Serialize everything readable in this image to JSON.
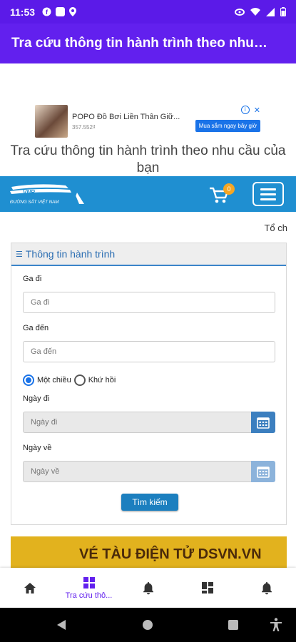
{
  "status_bar": {
    "time": "11:53",
    "brand_color": "#5b1ae8"
  },
  "app_bar": {
    "title": "Tra cứu thông tin hành trình theo nhu…"
  },
  "ad": {
    "title": "POPO Đồ Bơi Liền Thân Giữ...",
    "price": "357.552₫",
    "cta": "Mua sắm ngay bây giờ"
  },
  "page_title": "Tra cứu thông tin hành trình theo nhu cầu của bạn",
  "site_header": {
    "logo_text": "VNR",
    "logo_caption": "ĐƯỜNG SẮT VIỆT NAM",
    "cart_count": "0",
    "header_color": "#1f8fd1"
  },
  "top_link": "Tổ ch",
  "panel": {
    "title": "Thông tin hành trình",
    "departure_label": "Ga đi",
    "departure_placeholder": "Ga đi",
    "arrival_label": "Ga đến",
    "arrival_placeholder": "Ga đến",
    "one_way_label": "Một chiều",
    "round_trip_label": "Khứ hồi",
    "selected_trip_type": "one_way",
    "depart_date_label": "Ngày đi",
    "depart_date_placeholder": "Ngày đi",
    "return_date_label": "Ngày về",
    "return_date_placeholder": "Ngày về",
    "search_button": "Tìm kiếm"
  },
  "banner": {
    "text": "VÉ TÀU ĐIỆN TỬ DSVN.VN"
  },
  "bottom_nav": {
    "items": [
      {
        "icon": "home-icon"
      },
      {
        "icon": "grid-icon",
        "label": "Tra cứu thô...",
        "active": true
      },
      {
        "icon": "bell-icon"
      },
      {
        "icon": "dashboard-icon"
      },
      {
        "icon": "bell-icon"
      }
    ],
    "active_color": "#6220ee"
  }
}
